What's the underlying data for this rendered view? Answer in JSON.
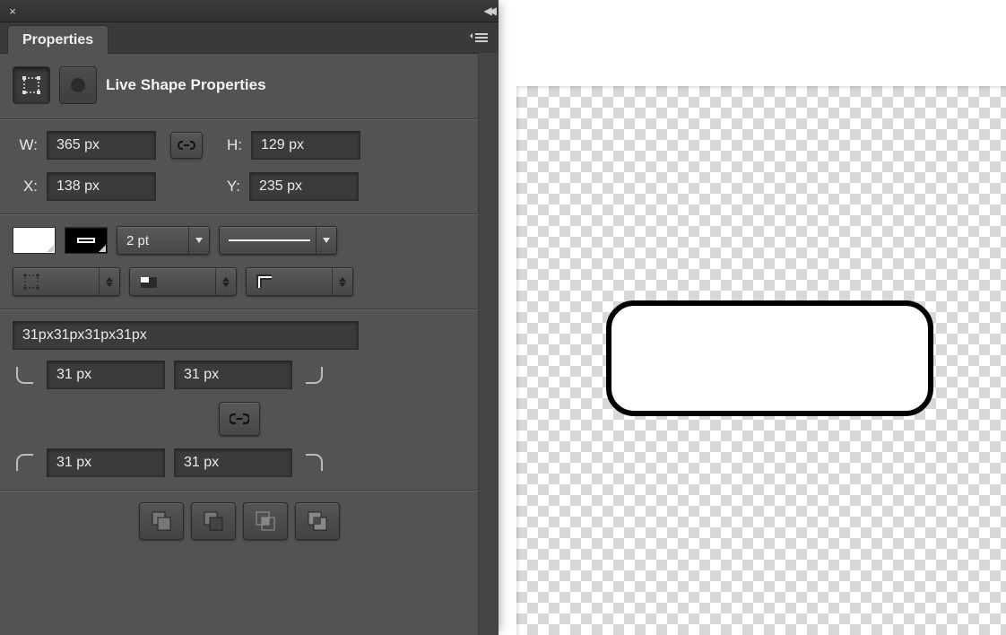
{
  "panel": {
    "tab_label": "Properties",
    "title": "Live Shape Properties"
  },
  "transform": {
    "w_label": "W:",
    "w_value": "365 px",
    "h_label": "H:",
    "h_value": "129 px",
    "x_label": "X:",
    "x_value": "138 px",
    "y_label": "Y:",
    "y_value": "235 px"
  },
  "appearance": {
    "stroke_width": "2 pt"
  },
  "corners": {
    "summary": "31px31px31px31px",
    "tl": "31 px",
    "tr": "31 px",
    "bl": "31 px",
    "br": "31 px"
  }
}
